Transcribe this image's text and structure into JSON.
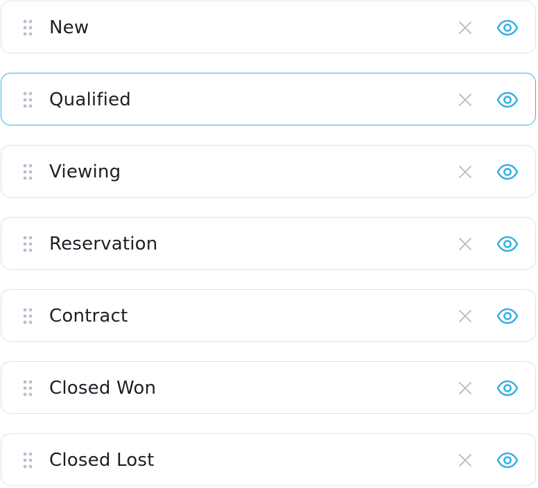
{
  "stages": [
    {
      "label": "New",
      "active": false
    },
    {
      "label": "Qualified",
      "active": true
    },
    {
      "label": "Viewing",
      "active": false
    },
    {
      "label": "Reservation",
      "active": false
    },
    {
      "label": "Contract",
      "active": false
    },
    {
      "label": "Closed Won",
      "active": false
    },
    {
      "label": "Closed Lost",
      "active": false
    }
  ],
  "icons": {
    "handle": "drag-handle-icon",
    "remove": "close-icon",
    "visibility": "eye-icon"
  },
  "colors": {
    "accent": "#3ab0e2",
    "border": "#dde2ea",
    "muted_icon": "#b8c1d1",
    "text": "#1c1f26"
  }
}
